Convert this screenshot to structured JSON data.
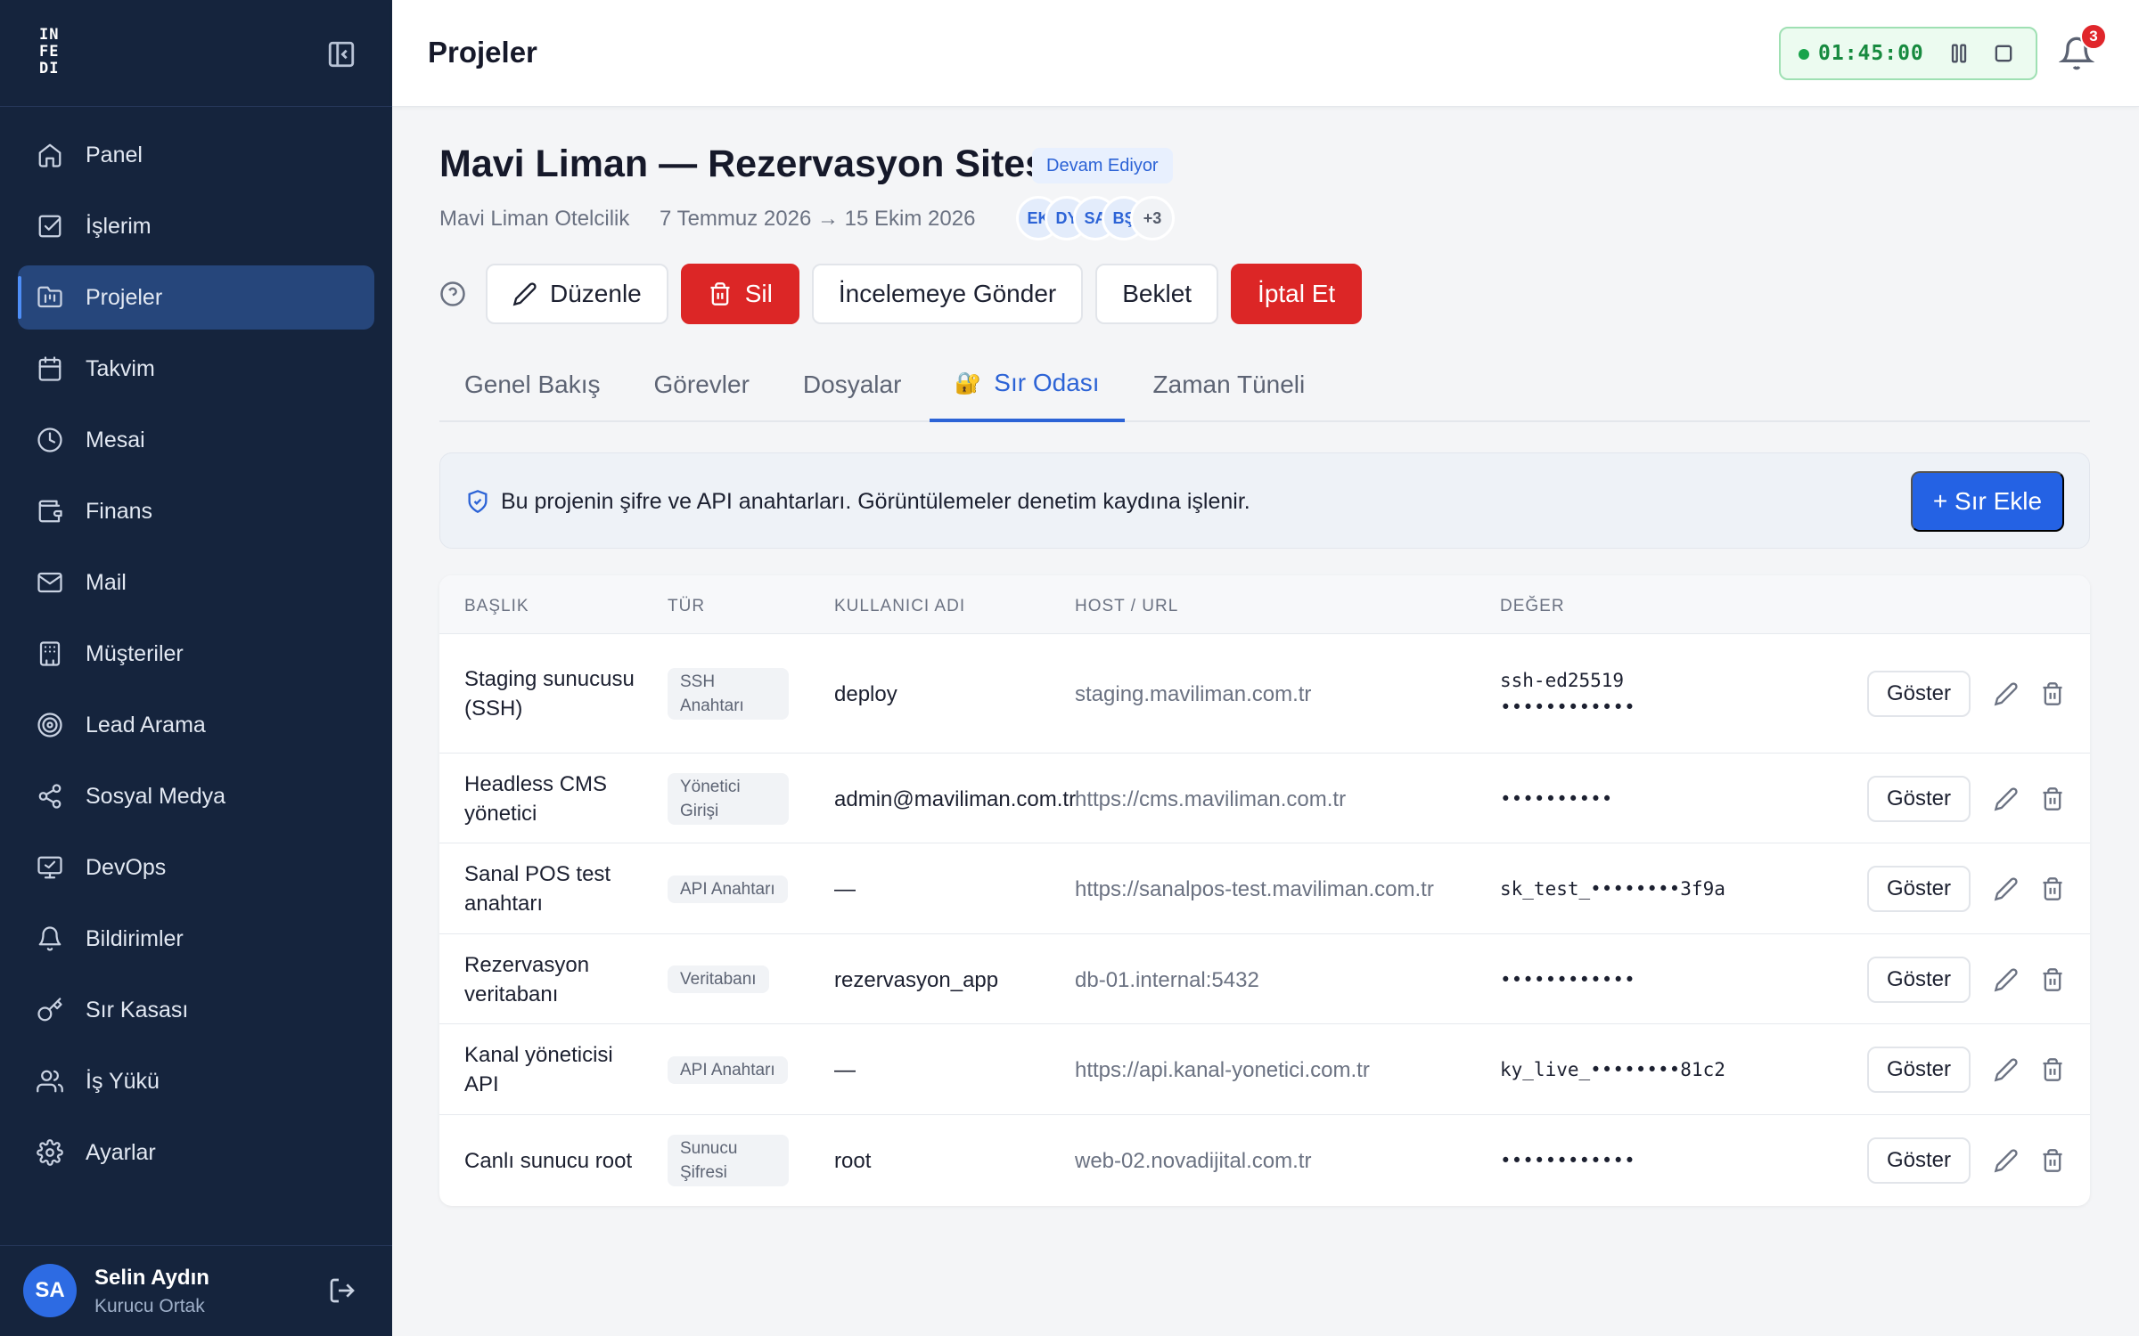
{
  "sidebar": {
    "logo": [
      "IN",
      "FE",
      "DI"
    ],
    "items": [
      {
        "label": "Panel",
        "icon": "home-icon"
      },
      {
        "label": "İşlerim",
        "icon": "checkbox-icon"
      },
      {
        "label": "Projeler",
        "icon": "folder-kanban-icon",
        "active": true
      },
      {
        "label": "Takvim",
        "icon": "calendar-icon"
      },
      {
        "label": "Mesai",
        "icon": "clock-icon"
      },
      {
        "label": "Finans",
        "icon": "wallet-icon"
      },
      {
        "label": "Mail",
        "icon": "mail-icon"
      },
      {
        "label": "Müşteriler",
        "icon": "building-icon"
      },
      {
        "label": "Lead Arama",
        "icon": "target-icon"
      },
      {
        "label": "Sosyal Medya",
        "icon": "share-icon"
      },
      {
        "label": "DevOps",
        "icon": "monitor-icon"
      },
      {
        "label": "Bildirimler",
        "icon": "bell-icon"
      },
      {
        "label": "Sır Kasası",
        "icon": "key-icon"
      },
      {
        "label": "İş Yükü",
        "icon": "users-icon"
      },
      {
        "label": "Ayarlar",
        "icon": "gear-icon"
      }
    ],
    "user": {
      "initials": "SA",
      "name": "Selin Aydın",
      "role": "Kurucu Ortak"
    }
  },
  "topbar": {
    "title": "Projeler",
    "timer": "01:45:00",
    "notifications": "3"
  },
  "project": {
    "title": "Mavi Liman — Rezervasyon Sitesi",
    "status": "Devam Ediyor",
    "client": "Mavi Liman Otelcilik",
    "dates": "7 Temmuz 2026 → 15 Ekim 2026",
    "members": [
      "EK",
      "DY",
      "SA",
      "BŞ"
    ],
    "more_members": "+3"
  },
  "actions": {
    "edit": "Düzenle",
    "delete": "Sil",
    "review": "İncelemeye Gönder",
    "hold": "Beklet",
    "cancel": "İptal Et"
  },
  "tabs": [
    "Genel Bakış",
    "Görevler",
    "Dosyalar",
    "Sır Odası",
    "Zaman Tüneli"
  ],
  "active_tab": "Sır Odası",
  "vault": {
    "info": "Bu projenin şifre ve API anahtarları. Görüntülemeler denetim kaydına işlenir.",
    "add_label": "+ Sır Ekle",
    "columns": [
      "BAŞLIK",
      "TÜR",
      "KULLANICI ADI",
      "HOST / URL",
      "DEĞER"
    ],
    "show_label": "Göster",
    "rows": [
      {
        "title": "Staging sunucusu (SSH)",
        "type": "SSH Anahtarı",
        "user": "deploy",
        "host": "staging.maviliman.com.tr",
        "value": "ssh-ed25519 ••••••••••••"
      },
      {
        "title": "Headless CMS yönetici",
        "type": "Yönetici Girişi",
        "user": "admin@maviliman.com.tr",
        "host": "https://cms.maviliman.com.tr",
        "value": "••••••••••"
      },
      {
        "title": "Sanal POS test anahtarı",
        "type": "API Anahtarı",
        "user": "—",
        "host": "https://sanalpos-test.maviliman.com.tr",
        "value": "sk_test_••••••••3f9a"
      },
      {
        "title": "Rezervasyon veritabanı",
        "type": "Veritabanı",
        "user": "rezervasyon_app",
        "host": "db-01.internal:5432",
        "value": "••••••••••••"
      },
      {
        "title": "Kanal yöneticisi API",
        "type": "API Anahtarı",
        "user": "—",
        "host": "https://api.kanal-yonetici.com.tr",
        "value": "ky_live_••••••••81c2"
      },
      {
        "title": "Canlı sunucu root",
        "type": "Sunucu Şifresi",
        "user": "root",
        "host": "web-02.novadijital.com.tr",
        "value": "••••••••••••"
      }
    ]
  }
}
